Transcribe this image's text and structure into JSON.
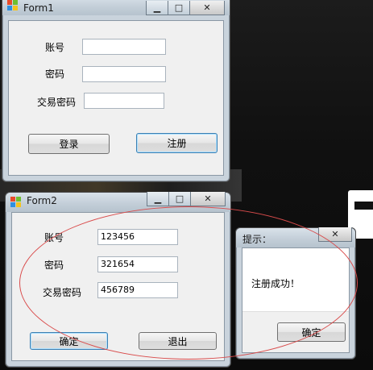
{
  "form1": {
    "title": "Form1",
    "account_label": "账号",
    "password_label": "密码",
    "trade_password_label": "交易密码",
    "account_value": "",
    "password_value": "",
    "trade_password_value": "",
    "login_button": "登录",
    "register_button": "注册"
  },
  "form2": {
    "title": "Form2",
    "account_label": "账号",
    "password_label": "密码",
    "trade_password_label": "交易密码",
    "account_value": "123456",
    "password_value": "321654",
    "trade_password_value": "456789",
    "confirm_button": "确定",
    "exit_button": "退出"
  },
  "dialog": {
    "title": "提示：",
    "message": "注册成功！",
    "ok_button": "确定"
  },
  "caption": {
    "minimize": "▁",
    "maximize": "□",
    "close": "✕"
  },
  "colors": {
    "annotation_ellipse": "#d94b4b",
    "default_button_border": "#3c7fb1"
  }
}
